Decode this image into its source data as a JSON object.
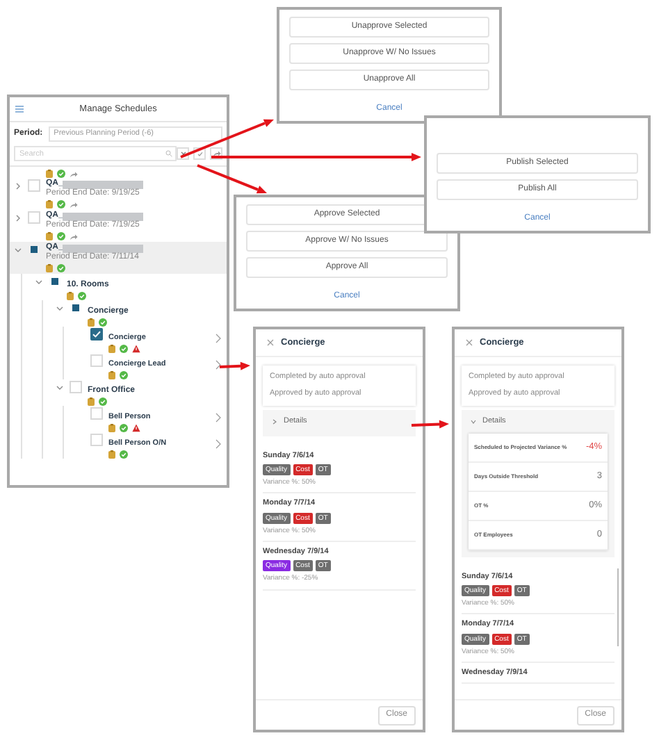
{
  "manage": {
    "title": "Manage Schedules",
    "period_label": "Period:",
    "period_value": "Previous Planning Period (-6)",
    "search_placeholder": "Search",
    "tree": [
      {
        "kind": "stub",
        "share": true,
        "warning": false
      },
      {
        "kind": "schedule",
        "label": "QA_",
        "subtitle": "Period End Date: 9/19/25",
        "expanded": false,
        "selected": false,
        "checked": false,
        "partial": false,
        "share": true,
        "warning": false
      },
      {
        "kind": "schedule",
        "label": "QA_",
        "subtitle": "Period End Date: 7/19/25",
        "expanded": false,
        "selected": false,
        "checked": false,
        "partial": false,
        "share": true,
        "warning": false
      },
      {
        "kind": "schedule",
        "label": "QA_",
        "subtitle": "Period End Date: 7/11/14",
        "expanded": true,
        "selected": true,
        "partial": true,
        "share": false,
        "warning": false,
        "children": [
          {
            "kind": "group",
            "label": "10. Rooms",
            "expanded": true,
            "partial": true,
            "share": false,
            "warning": false,
            "children": [
              {
                "kind": "group",
                "label": "Concierge",
                "expanded": true,
                "partial": true,
                "share": false,
                "warning": false,
                "children": [
                  {
                    "kind": "position",
                    "label": "Concierge",
                    "checked": true,
                    "share": false,
                    "warning": true
                  },
                  {
                    "kind": "position",
                    "label": "Concierge Lead",
                    "checked": false,
                    "partial": false,
                    "share": false,
                    "warning": false
                  }
                ]
              },
              {
                "kind": "group",
                "label": "Front Office",
                "expanded": true,
                "checked": false,
                "partial": false,
                "share": false,
                "warning": false,
                "children": [
                  {
                    "kind": "position",
                    "label": "Bell Person",
                    "checked": false,
                    "partial": false,
                    "share": false,
                    "warning": true
                  },
                  {
                    "kind": "position",
                    "label": "Bell Person O/N",
                    "checked": false,
                    "partial": false,
                    "share": false,
                    "warning": false
                  }
                ]
              }
            ]
          }
        ]
      }
    ]
  },
  "unapprove_dialog": {
    "buttons": [
      "Unapprove Selected",
      "Unapprove W/ No Issues",
      "Unapprove All"
    ],
    "cancel": "Cancel"
  },
  "approve_dialog": {
    "buttons": [
      "Approve Selected",
      "Approve W/ No Issues",
      "Approve All"
    ],
    "cancel": "Cancel"
  },
  "publish_dialog": {
    "buttons": [
      "Publish Selected",
      "Publish All"
    ],
    "cancel": "Cancel"
  },
  "detail_panels": [
    {
      "title": "Concierge",
      "notes": [
        "Completed by auto approval",
        "Approved by auto approval"
      ],
      "details_label": "Details",
      "expanded": false,
      "days": [
        {
          "date": "Sunday 7/6/14",
          "tags": [
            {
              "label": "Quality",
              "color": "#6e6e6e"
            },
            {
              "label": "Cost",
              "color": "#d42a2a"
            },
            {
              "label": "OT",
              "color": "#6e6e6e"
            }
          ],
          "variance": "Variance %: 50%"
        },
        {
          "date": "Monday 7/7/14",
          "tags": [
            {
              "label": "Quality",
              "color": "#6e6e6e"
            },
            {
              "label": "Cost",
              "color": "#d42a2a"
            },
            {
              "label": "OT",
              "color": "#6e6e6e"
            }
          ],
          "variance": "Variance %: 50%"
        },
        {
          "date": "Wednesday 7/9/14",
          "tags": [
            {
              "label": "Quality",
              "color": "#8a2be2"
            },
            {
              "label": "Cost",
              "color": "#6e6e6e"
            },
            {
              "label": "OT",
              "color": "#6e6e6e"
            }
          ],
          "variance": "Variance %: -25%"
        }
      ],
      "close": "Close"
    },
    {
      "title": "Concierge",
      "notes": [
        "Completed by auto approval",
        "Approved by auto approval"
      ],
      "details_label": "Details",
      "expanded": true,
      "metrics": [
        {
          "label": "Scheduled to Projected Variance %",
          "value": "-4%",
          "alert": true
        },
        {
          "label": "Days Outside Threshold",
          "value": "3",
          "alert": false
        },
        {
          "label": "OT %",
          "value": "0%",
          "alert": false
        },
        {
          "label": "OT Employees",
          "value": "0",
          "alert": false
        }
      ],
      "days": [
        {
          "date": "Sunday 7/6/14",
          "tags": [
            {
              "label": "Quality",
              "color": "#6e6e6e"
            },
            {
              "label": "Cost",
              "color": "#d42a2a"
            },
            {
              "label": "OT",
              "color": "#6e6e6e"
            }
          ],
          "variance": "Variance %: 50%"
        },
        {
          "date": "Monday 7/7/14",
          "tags": [
            {
              "label": "Quality",
              "color": "#6e6e6e"
            },
            {
              "label": "Cost",
              "color": "#d42a2a"
            },
            {
              "label": "OT",
              "color": "#6e6e6e"
            }
          ],
          "variance": "Variance %: 50%"
        },
        {
          "date": "Wednesday 7/9/14"
        }
      ],
      "close": "Close"
    }
  ]
}
